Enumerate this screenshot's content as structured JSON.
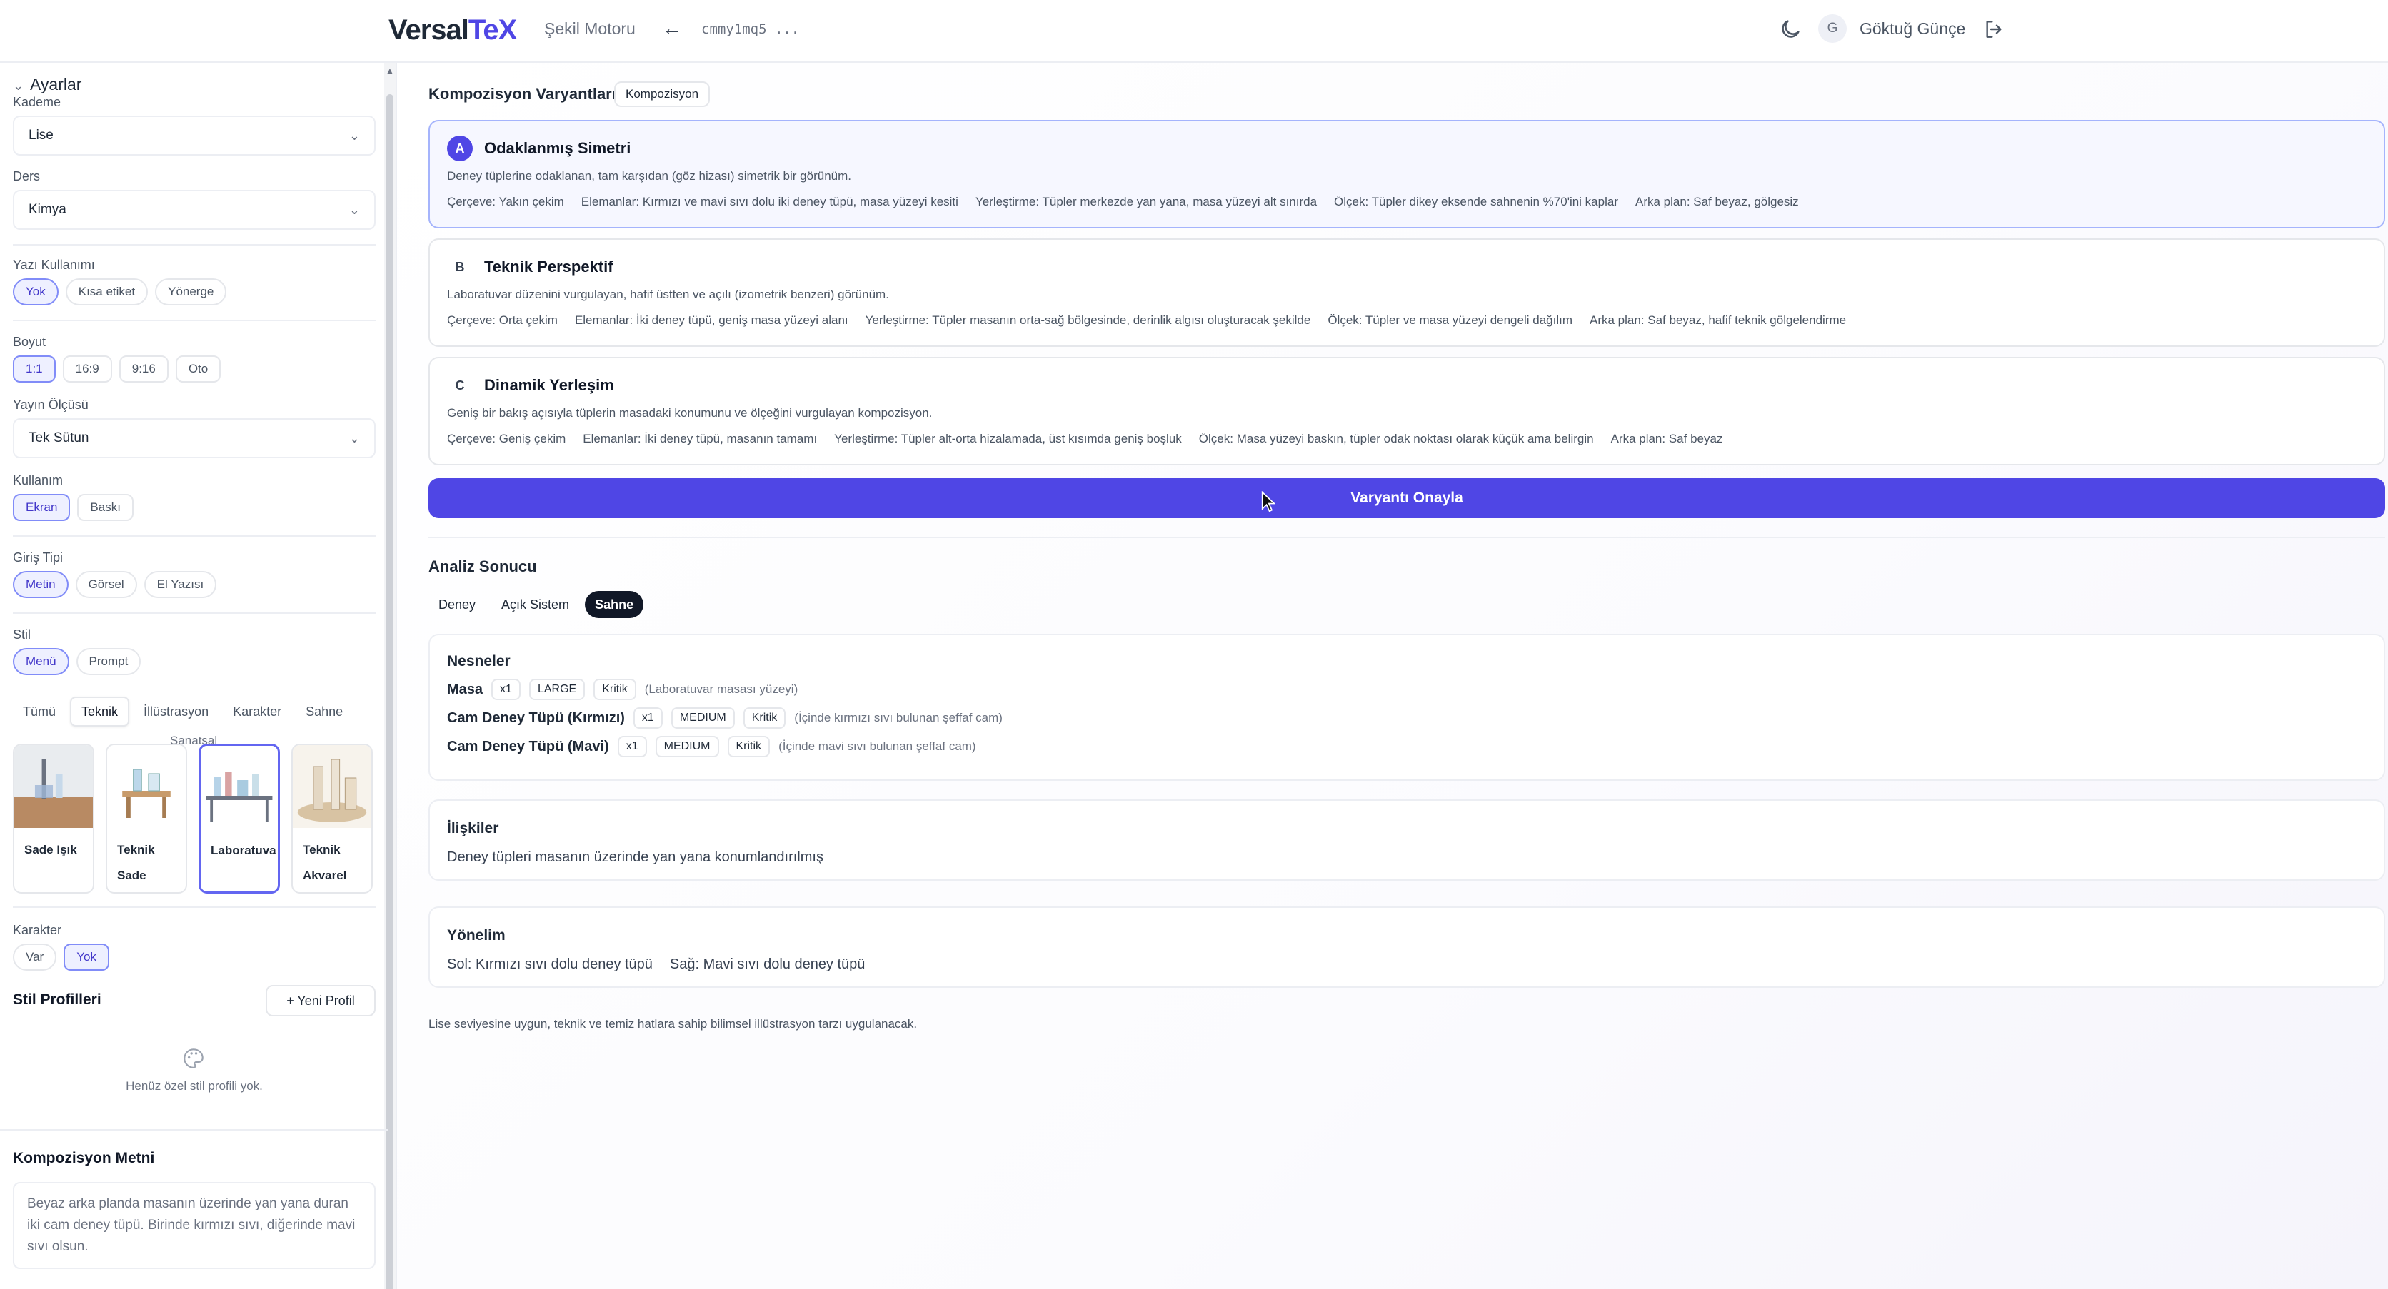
{
  "header": {
    "logo_main": "Versal",
    "logo_accent": "TeX",
    "nav_label": "Şekil Motoru",
    "doc_id": "cmmy1mq5 ...",
    "avatar_initial": "G",
    "user_name": "Göktuğ Günçe"
  },
  "sidebar": {
    "section_title": "Ayarlar",
    "kademe": {
      "label": "Kademe",
      "value": "Lise"
    },
    "ders": {
      "label": "Ders",
      "value": "Kimya"
    },
    "yazi_kullanimi": {
      "label": "Yazı Kullanımı",
      "options": [
        "Yok",
        "Kısa etiket",
        "Yönerge"
      ],
      "selected": "Yok"
    },
    "boyut": {
      "label": "Boyut",
      "options": [
        "1:1",
        "16:9",
        "9:16",
        "Oto"
      ],
      "selected": "1:1"
    },
    "yayin_olcusu": {
      "label": "Yayın Ölçüsü",
      "value": "Tek Sütun"
    },
    "kullanim": {
      "label": "Kullanım",
      "options": [
        "Ekran",
        "Baskı"
      ],
      "selected": "Ekran"
    },
    "giris_tipi": {
      "label": "Giriş Tipi",
      "options": [
        "Metin",
        "Görsel",
        "El Yazısı"
      ],
      "selected": "Metin"
    },
    "stil": {
      "label": "Stil",
      "options": [
        "Menü",
        "Prompt"
      ],
      "selected": "Menü"
    },
    "style_tabs": [
      "Tümü",
      "Teknik",
      "İllüstrasyon",
      "Karakter",
      "Sahne"
    ],
    "style_tab_selected": "Teknik",
    "style_sub_label": "Sanatsal",
    "style_cards": [
      {
        "name": "Sade Işık",
        "selected": false
      },
      {
        "name": "Teknik Sade",
        "selected": false
      },
      {
        "name": "Laboratuva",
        "selected": true
      },
      {
        "name": "Teknik Akvarel",
        "selected": false
      }
    ],
    "karakter": {
      "label": "Karakter",
      "options": [
        "Var",
        "Yok"
      ],
      "selected": "Yok"
    },
    "stil_profilleri": {
      "title": "Stil Profilleri",
      "new_button": "Yeni Profil",
      "empty_text": "Henüz özel stil profili yok."
    },
    "kompozisyon_metni": {
      "title": "Kompozisyon Metni",
      "text": "Beyaz arka planda masanın üzerinde yan yana duran iki cam deney tüpü. Birinde kırmızı sıvı, diğerinde mavi sıvı olsun."
    }
  },
  "main": {
    "variants_title": "Kompozisyon Varyantları",
    "variants_badge": "Kompozisyon",
    "variants": [
      {
        "letter": "A",
        "name": "Odaklanmış Simetri",
        "description": "Deney tüplerine odaklanan, tam karşıdan (göz hizası) simetrik bir görünüm.",
        "attrs": [
          "Çerçeve: Yakın çekim",
          "Elemanlar: Kırmızı ve mavi sıvı dolu iki deney tüpü, masa yüzeyi kesiti",
          "Yerleştirme: Tüpler merkezde yan yana, masa yüzeyi alt sınırda",
          "Ölçek: Tüpler dikey eksende sahnenin %70'ini kaplar",
          "Arka plan: Saf beyaz, gölgesiz"
        ],
        "selected": true
      },
      {
        "letter": "B",
        "name": "Teknik Perspektif",
        "description": "Laboratuvar düzenini vurgulayan, hafif üstten ve açılı (izometrik benzeri) görünüm.",
        "attrs": [
          "Çerçeve: Orta çekim",
          "Elemanlar: İki deney tüpü, geniş masa yüzeyi alanı",
          "Yerleştirme: Tüpler masanın orta-sağ bölgesinde, derinlik algısı oluşturacak şekilde",
          "Ölçek: Tüpler ve masa yüzeyi dengeli dağılım",
          "Arka plan: Saf beyaz, hafif teknik gölgelendirme"
        ],
        "selected": false
      },
      {
        "letter": "C",
        "name": "Dinamik Yerleşim",
        "description": "Geniş bir bakış açısıyla tüplerin masadaki konumunu ve ölçeğini vurgulayan kompozisyon.",
        "attrs": [
          "Çerçeve: Geniş çekim",
          "Elemanlar: İki deney tüpü, masanın tamamı",
          "Yerleştirme: Tüpler alt-orta hizalamada, üst kısımda geniş boşluk",
          "Ölçek: Masa yüzeyi baskın, tüpler odak noktası olarak küçük ama belirgin",
          "Arka plan: Saf beyaz"
        ],
        "selected": false
      }
    ],
    "approve_button": "Varyantı Onayla",
    "analysis_title": "Analiz Sonucu",
    "analysis_tabs": [
      "Deney",
      "Açık Sistem",
      "Sahne"
    ],
    "analysis_tab_selected": "Sahne",
    "nesneler": {
      "title": "Nesneler",
      "items": [
        {
          "name": "Masa",
          "count": "x1",
          "size": "LARGE",
          "priority": "Kritik",
          "note": "(Laboratuvar masası yüzeyi)"
        },
        {
          "name": "Cam Deney Tüpü (Kırmızı)",
          "count": "x1",
          "size": "MEDIUM",
          "priority": "Kritik",
          "note": "(İçinde kırmızı sıvı bulunan şeffaf cam)"
        },
        {
          "name": "Cam Deney Tüpü (Mavi)",
          "count": "x1",
          "size": "MEDIUM",
          "priority": "Kritik",
          "note": "(İçinde mavi sıvı bulunan şeffaf cam)"
        }
      ]
    },
    "iliskiler": {
      "title": "İlişkiler",
      "text": "Deney tüpleri masanın üzerinde yan yana konumlandırılmış"
    },
    "yonelim": {
      "title": "Yönelim",
      "left": "Sol: Kırmızı sıvı dolu deney tüpü",
      "right": "Sağ: Mavi sıvı dolu deney tüpü"
    },
    "footer_note": "Lise seviyesine uygun, teknik ve temiz hatlara sahip bilimsel illüstrasyon tarzı uygulanacak."
  },
  "colors": {
    "accent": "#4f46e5",
    "accent_light": "#eef0ff"
  }
}
